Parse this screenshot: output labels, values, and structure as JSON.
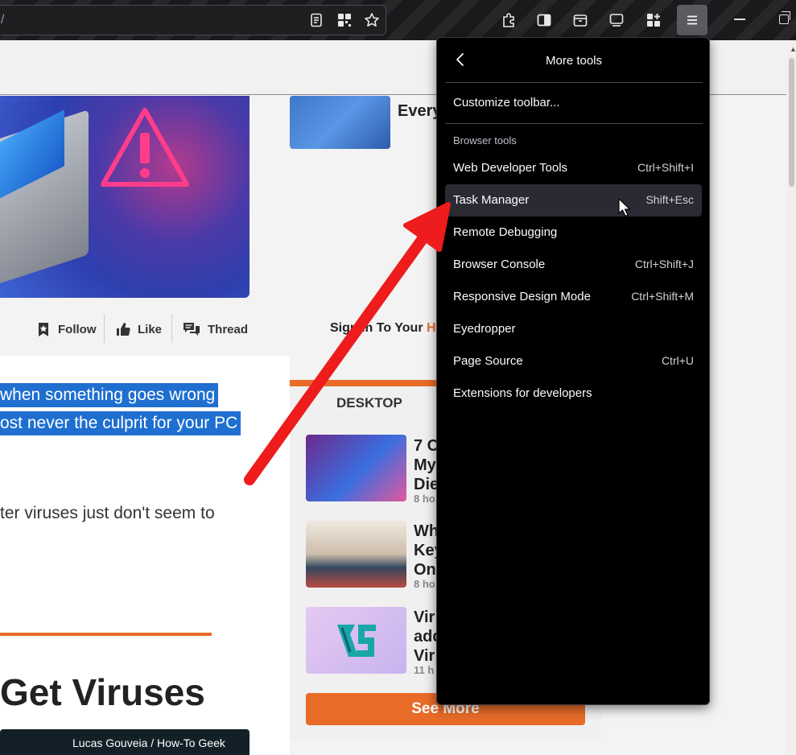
{
  "browser": {
    "url_fragment": "/"
  },
  "colors": {
    "accent_orange": "#e86b28",
    "highlight_blue": "#1e6fd0",
    "panel_bg": "#000000",
    "arrow_red": "#ee1c1c"
  },
  "article": {
    "social": {
      "follow": "Follow",
      "like": "Like",
      "thread": "Thread"
    },
    "signin_text": "Sign In To Your",
    "highlighted_lines": [
      "when something goes wrong",
      "ost never the culprit for your PC"
    ],
    "body_line": "ter viruses just don't seem to",
    "heading": "Get Viruses",
    "image_credit": "Lucas Gouveia / How-To Geek"
  },
  "sidebar": {
    "top_item_heading": "Every",
    "section_title": "DESKTOP",
    "items": [
      {
        "heading_lines": [
          "7 C",
          "My",
          "Die"
        ],
        "meta": "8 ho"
      },
      {
        "heading_lines": [
          "Wh",
          "Key",
          "One"
        ],
        "meta": "8 ho"
      },
      {
        "heading_lines": [
          "Vir",
          "add",
          "Vir"
        ],
        "meta": "11 h"
      }
    ],
    "see_more": "See More"
  },
  "more_tools_panel": {
    "title": "More tools",
    "customize": "Customize toolbar...",
    "group_label": "Browser tools",
    "items": [
      {
        "label": "Web Developer Tools",
        "shortcut": "Ctrl+Shift+I"
      },
      {
        "label": "Task Manager",
        "shortcut": "Shift+Esc"
      },
      {
        "label": "Remote Debugging",
        "shortcut": ""
      },
      {
        "label": "Browser Console",
        "shortcut": "Ctrl+Shift+J"
      },
      {
        "label": "Responsive Design Mode",
        "shortcut": "Ctrl+Shift+M"
      },
      {
        "label": "Eyedropper",
        "shortcut": ""
      },
      {
        "label": "Page Source",
        "shortcut": "Ctrl+U"
      },
      {
        "label": "Extensions for developers",
        "shortcut": ""
      }
    ],
    "hovered_item": "Task Manager"
  }
}
